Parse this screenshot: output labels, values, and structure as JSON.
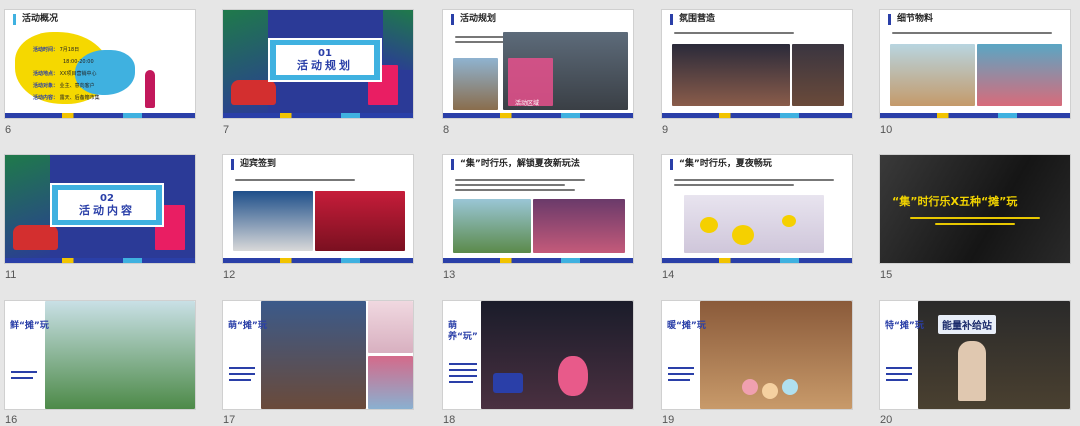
{
  "slides": [
    {
      "num": "6",
      "title": "活动概况",
      "lines": [
        {
          "k": "活动时间：",
          "v": "7月18日"
        },
        {
          "k": "",
          "v": "18:00-20:00"
        },
        {
          "k": "活动地点：",
          "v": "XX项目营销中心"
        },
        {
          "k": "活动对象：",
          "v": "业主、意向客户"
        },
        {
          "k": "活动内容：",
          "v": "露天、后备箱市集"
        }
      ]
    },
    {
      "num": "7",
      "section_no": "01",
      "section_title": "活动规划"
    },
    {
      "num": "8",
      "title": "活动规划",
      "caption": "活动区域"
    },
    {
      "num": "9",
      "title": "氛围营造"
    },
    {
      "num": "10",
      "title": "细节物料"
    },
    {
      "num": "11",
      "section_no": "02",
      "section_title": "活动内容"
    },
    {
      "num": "12",
      "title": "迎宾签到"
    },
    {
      "num": "13",
      "title": "“集”时行乐，解锁夏夜新玩法"
    },
    {
      "num": "14",
      "title": "“集”时行乐，夏夜畅玩"
    },
    {
      "num": "15",
      "headline": "“集”时行乐X五种“摊”玩"
    },
    {
      "num": "16",
      "side": "鲜“摊”玩"
    },
    {
      "num": "17",
      "side": "萌“摊”玩"
    },
    {
      "num": "18",
      "side": "萌养“玩”"
    },
    {
      "num": "19",
      "side": "暖“摊”玩"
    },
    {
      "num": "20",
      "side": "特“摊”玩",
      "sign": "能量补给站"
    }
  ],
  "colors": {
    "background": "#e6e6e6",
    "accent": "#2a3fa8",
    "yellow": "#f2c400",
    "sky": "#3fb1e0"
  }
}
